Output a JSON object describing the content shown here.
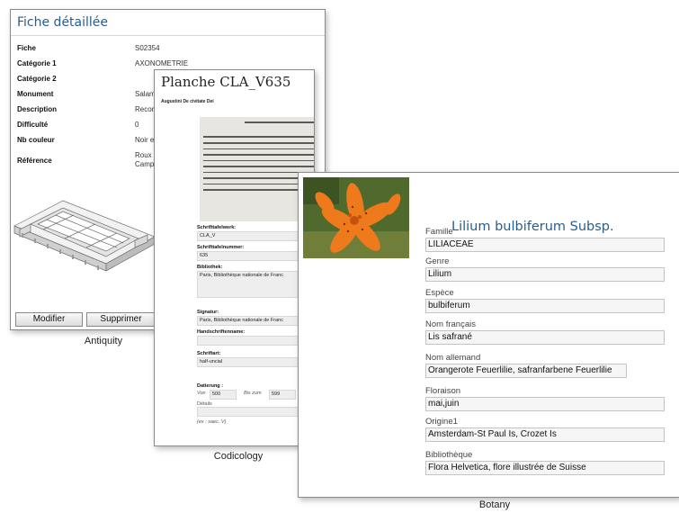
{
  "antiquity": {
    "title": "Fiche détaillée",
    "rows": [
      {
        "label": "Fiche",
        "value": "S02354"
      },
      {
        "label": "Catégorie 1",
        "value": "AXONOMETRIE"
      },
      {
        "label": "Catégorie 2",
        "value": ""
      },
      {
        "label": "Monument",
        "value": "Salami"
      },
      {
        "label": "Description",
        "value": "Recons"
      },
      {
        "label": "Difficulté",
        "value": "0"
      },
      {
        "label": "Nb couleur",
        "value": "Noir et"
      },
      {
        "label": "Référence",
        "value": "Roux G\nCampa"
      }
    ],
    "buttons": {
      "modify": "Modifier",
      "delete": "Supprimer"
    },
    "caption": "Antiquity"
  },
  "codicology": {
    "title": "Planche CLA_V635",
    "subtitle": "Augustini De civitate Dei",
    "fields": {
      "schrifttafelwerk": {
        "label": "Schrifttafelwerk:",
        "value": "CLA_V"
      },
      "schrifttafelnummer": {
        "label": "Schrifttafelnummer:",
        "value": "635"
      },
      "bibliothek": {
        "label": "Bibliothek:",
        "value": "Paris, Bibliothèque nationale de Franc"
      },
      "signatur": {
        "label": "Signatur:",
        "value": "Paris, Bibliothèque nationale de Franc"
      },
      "handschriftenname": {
        "label": "Handschriftenname:",
        "value": ""
      },
      "schriftart": {
        "label": "Schriftart:",
        "value": "half-uncial"
      }
    },
    "datierung": {
      "label": "Datierung :",
      "von_label": "Von",
      "von_value": "500",
      "bis_label": "Bis zum",
      "bis_value": "599",
      "details_label": "Détails",
      "details_value": "",
      "hint": "(ex : saec. V)"
    },
    "caption": "Codicology"
  },
  "botany": {
    "title": "Lilium bulbiferum Subsp.",
    "fields": [
      {
        "label": "Famille",
        "value": "LILIACEAE"
      },
      {
        "label": "Genre",
        "value": "Lilium"
      },
      {
        "label": "Espèce",
        "value": "bulbiferum"
      },
      {
        "label": "Nom français",
        "value": "Lis safrané"
      },
      {
        "label": "Nom allemand",
        "value": "Orangerote Feuerlilie, safranfarbene Feuerlilie"
      },
      {
        "label": "Floraison",
        "value": "mai,juin"
      },
      {
        "label": "Origine1",
        "value": "Amsterdam-St Paul Is, Crozet Is"
      },
      {
        "label": "Bibliothèque",
        "value": "Flora Helvetica, flore illustrée de Suisse"
      }
    ],
    "caption": "Botany"
  },
  "colors": {
    "title_blue": "#2a5d8c",
    "flower_orange": "#ee7a1c",
    "leaf_green": "#4f6a2c"
  }
}
